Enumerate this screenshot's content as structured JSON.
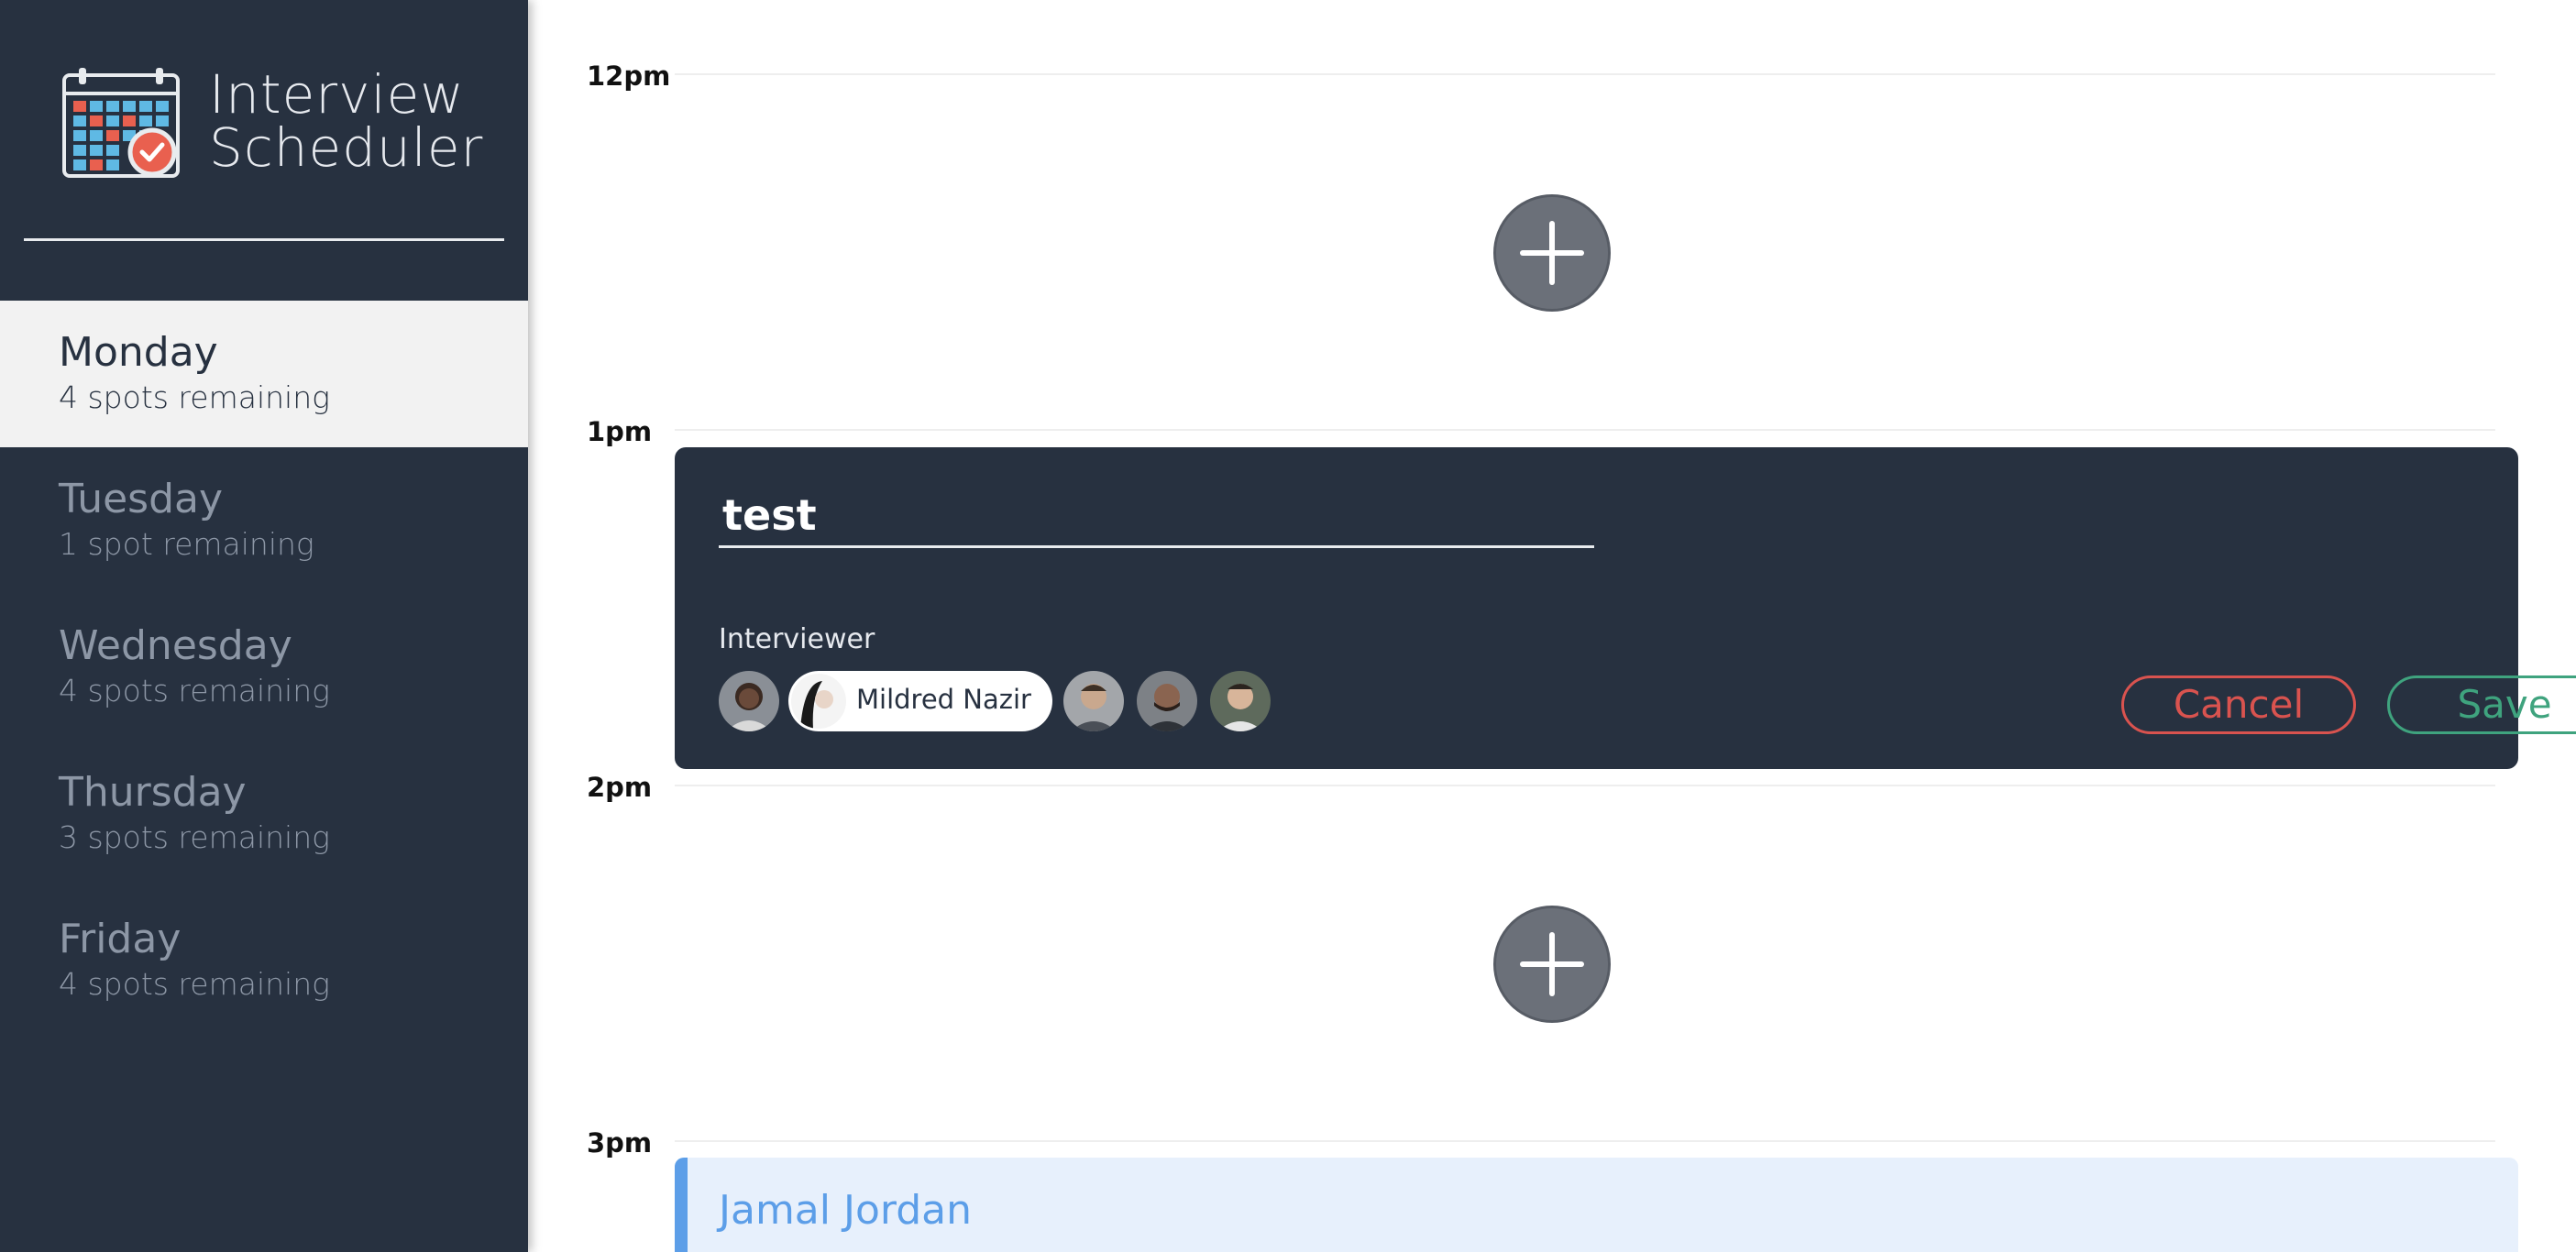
{
  "app": {
    "title_line1": "Interview",
    "title_line2": "Scheduler",
    "logo_icon": "calendar-check-icon"
  },
  "days": [
    {
      "name": "Monday",
      "spots": "4 spots remaining",
      "selected": true
    },
    {
      "name": "Tuesday",
      "spots": "1 spot remaining",
      "selected": false
    },
    {
      "name": "Wednesday",
      "spots": "4 spots remaining",
      "selected": false
    },
    {
      "name": "Thursday",
      "spots": "3 spots remaining",
      "selected": false
    },
    {
      "name": "Friday",
      "spots": "4 spots remaining",
      "selected": false
    }
  ],
  "schedule": {
    "times": [
      "12pm",
      "1pm",
      "2pm",
      "3pm"
    ],
    "add_icon": "plus-icon",
    "form": {
      "student_name": "test",
      "interviewer_label": "Interviewer",
      "selected_interviewer": "Mildred Nazir",
      "cancel_label": "Cancel",
      "save_label": "Save"
    },
    "booked_name": "Jamal Jordan"
  },
  "colors": {
    "sidebar_bg": "#273140",
    "selected_day_bg": "#f2f2f2",
    "cancel": "#d9534f",
    "save": "#3fa37e",
    "booked_accent": "#5c9ee8",
    "booked_bg": "#e7f0fc"
  }
}
